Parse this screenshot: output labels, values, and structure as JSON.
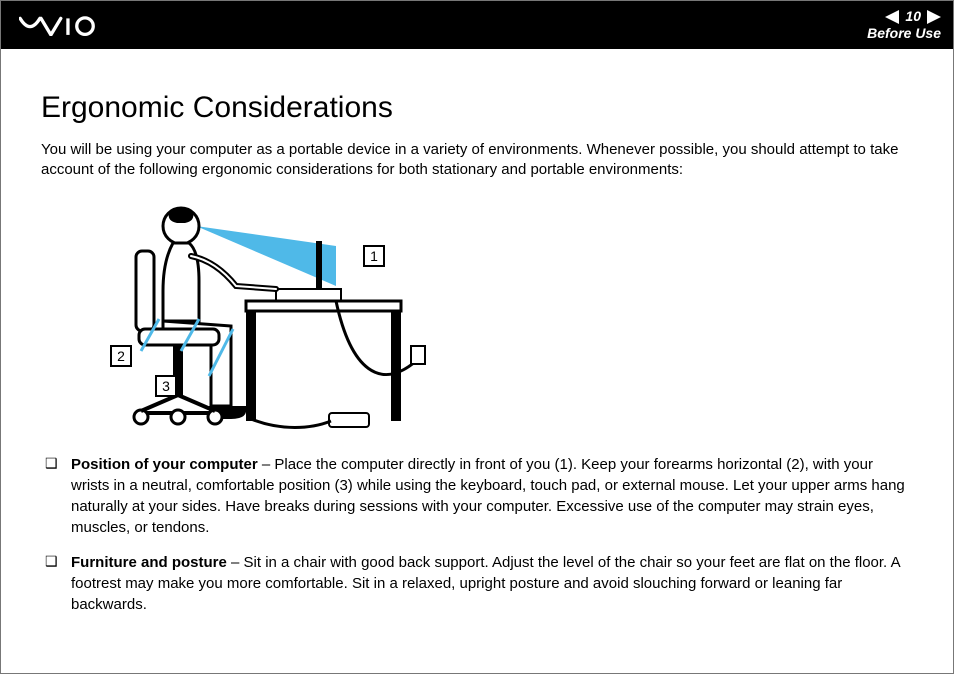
{
  "header": {
    "brand": "VAIO",
    "page_number": "10",
    "section_label": "Before Use"
  },
  "heading": "Ergonomic Considerations",
  "intro": "You will be using your computer as a portable device in a variety of environments. Whenever possible, you should attempt to take account of the following ergonomic considerations for both stationary and portable environments:",
  "figure": {
    "callouts": {
      "1": "1",
      "2": "2",
      "3": "3"
    }
  },
  "bullets": [
    {
      "title": "Position of your computer",
      "text": " – Place the computer directly in front of you (1). Keep your forearms horizontal (2), with your wrists in a neutral, comfortable position (3) while using the keyboard, touch pad, or external mouse. Let your upper arms hang naturally at your sides. Have breaks during sessions with your computer. Excessive use of the computer may strain eyes, muscles, or tendons."
    },
    {
      "title": "Furniture and posture",
      "text": " – Sit in a chair with good back support. Adjust the level of the chair so your feet are flat on the floor. A footrest may make you more comfortable. Sit in a relaxed, upright posture and avoid slouching forward or leaning far backwards."
    }
  ]
}
